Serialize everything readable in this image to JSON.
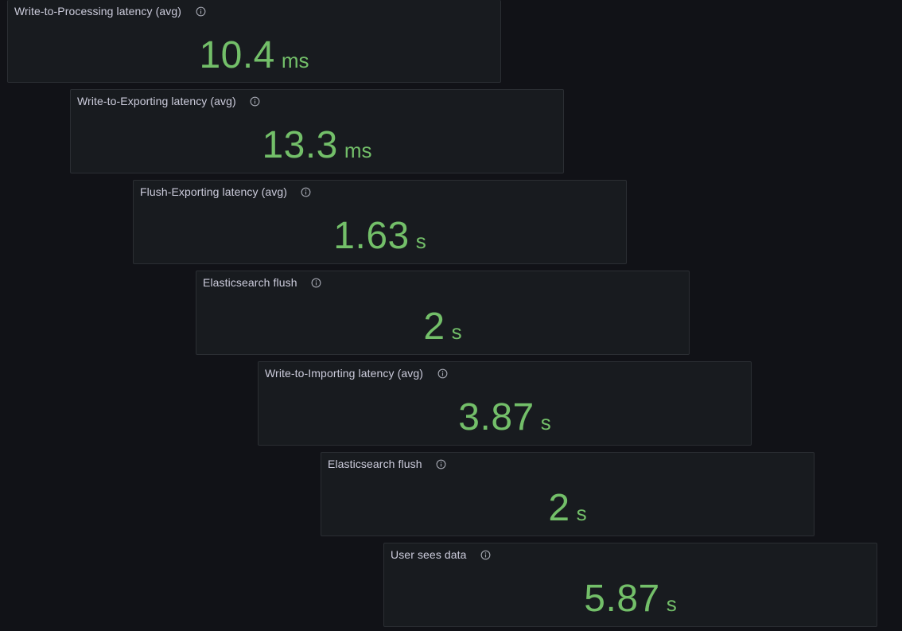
{
  "theme": {
    "background": "#111217",
    "panel_background": "#181b1f",
    "panel_border": "#2b2e33",
    "title_color": "#ccccdc",
    "value_color": "#73bf69"
  },
  "panels": [
    {
      "title": "Write-to-Processing latency (avg)",
      "value": "10.4",
      "unit": "ms",
      "icon": "info-icon"
    },
    {
      "title": "Write-to-Exporting latency (avg)",
      "value": "13.3",
      "unit": "ms",
      "icon": "info-icon"
    },
    {
      "title": "Flush-Exporting latency (avg)",
      "value": "1.63",
      "unit": "s",
      "icon": "info-icon"
    },
    {
      "title": "Elasticsearch flush",
      "value": "2",
      "unit": "s",
      "icon": "info-icon"
    },
    {
      "title": "Write-to-Importing latency (avg)",
      "value": "3.87",
      "unit": "s",
      "icon": "info-icon"
    },
    {
      "title": "Elasticsearch flush",
      "value": "2",
      "unit": "s",
      "icon": "info-icon"
    },
    {
      "title": "User sees data",
      "value": "5.87",
      "unit": "s",
      "icon": "info-icon"
    }
  ]
}
